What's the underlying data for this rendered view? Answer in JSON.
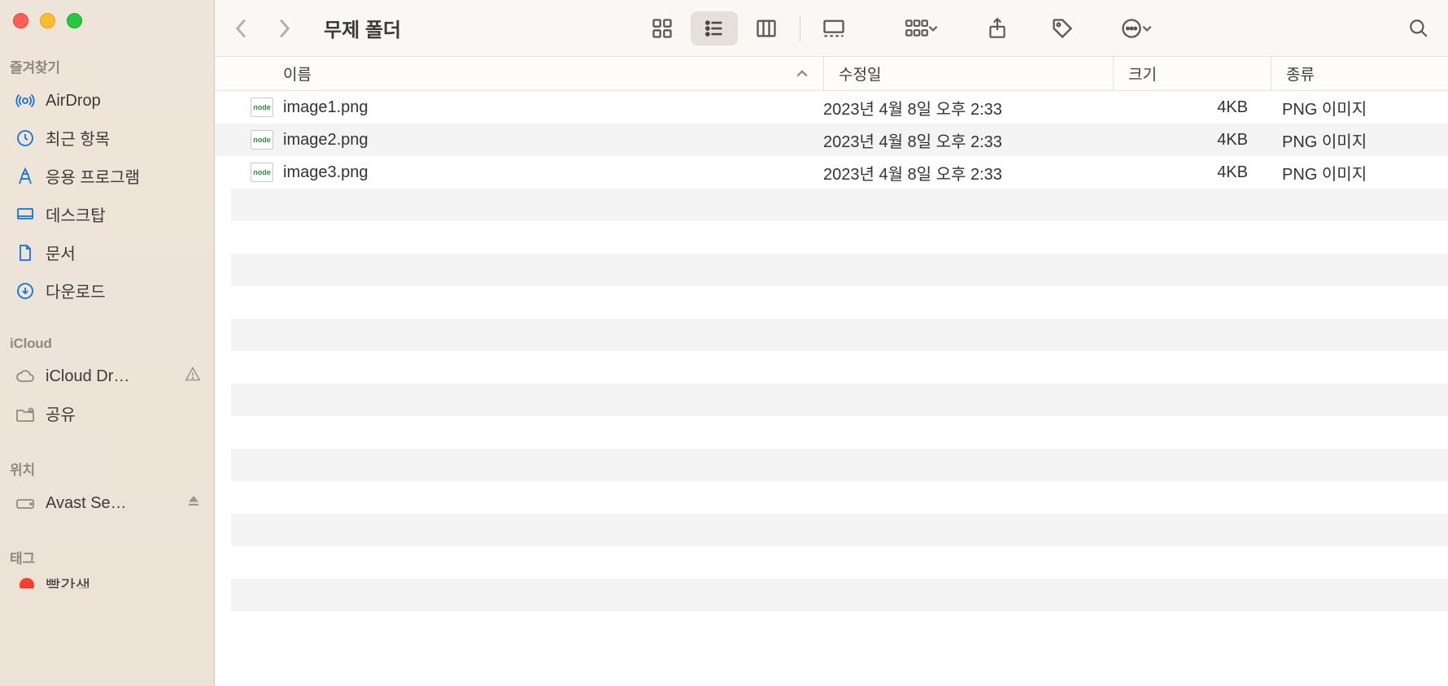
{
  "window": {
    "title": "무제 폴더"
  },
  "sidebar": {
    "sections": [
      {
        "title": "즐겨찾기",
        "items": [
          {
            "icon": "airdrop",
            "label": "AirDrop"
          },
          {
            "icon": "clock",
            "label": "최근 항목"
          },
          {
            "icon": "apps",
            "label": "응용 프로그램"
          },
          {
            "icon": "desktop",
            "label": "데스크탑"
          },
          {
            "icon": "document",
            "label": "문서"
          },
          {
            "icon": "download",
            "label": "다운로드"
          }
        ]
      },
      {
        "title": "iCloud",
        "items": [
          {
            "icon": "cloud",
            "label": "iCloud Dr…",
            "warn": true
          },
          {
            "icon": "shared",
            "label": "공유"
          }
        ]
      },
      {
        "title": "위치",
        "items": [
          {
            "icon": "disk",
            "label": "Avast Se…",
            "eject": true
          }
        ]
      },
      {
        "title": "태그",
        "items": [
          {
            "icon": "red-tag",
            "label": "빨간색",
            "partial": true
          }
        ]
      }
    ]
  },
  "columns": {
    "name": "이름",
    "date": "수정일",
    "size": "크기",
    "kind": "종류"
  },
  "files": [
    {
      "name": "image1.png",
      "date": "2023년 4월 8일 오후 2:33",
      "size": "4KB",
      "kind": "PNG 이미지"
    },
    {
      "name": "image2.png",
      "date": "2023년 4월 8일 오후 2:33",
      "size": "4KB",
      "kind": "PNG 이미지"
    },
    {
      "name": "image3.png",
      "date": "2023년 4월 8일 오후 2:33",
      "size": "4KB",
      "kind": "PNG 이미지"
    }
  ]
}
